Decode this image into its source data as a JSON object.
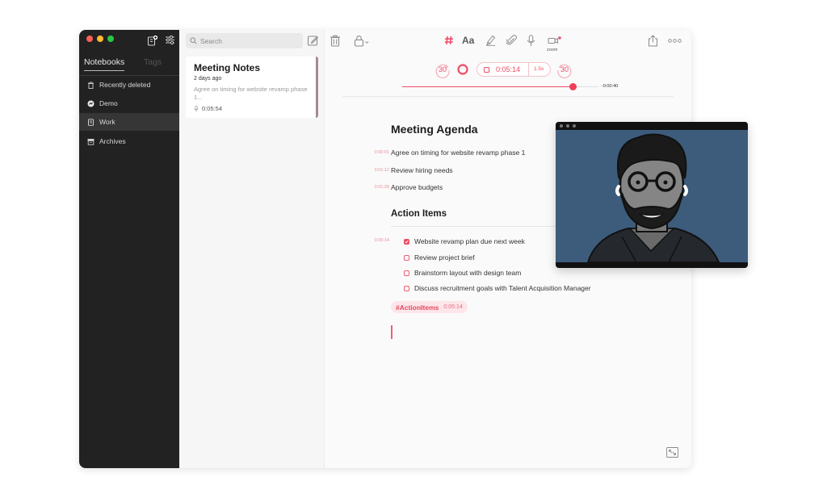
{
  "sidebar": {
    "tabs": [
      "Notebooks",
      "Tags"
    ],
    "items": [
      {
        "label": "Recently deleted",
        "icon": "trash-icon"
      },
      {
        "label": "Demo",
        "icon": "demo-icon"
      },
      {
        "label": "Work",
        "icon": "notebook-icon",
        "active": true
      },
      {
        "label": "Archives",
        "icon": "archive-icon"
      }
    ]
  },
  "toolbar": {
    "search_placeholder": "Search",
    "format_label": "Aa",
    "zoom_label": "zoom"
  },
  "note_card": {
    "title": "Meeting Notes",
    "date": "2 days ago",
    "preview": "Agree on timing for website revamp phase 1...",
    "duration": "0:05:54"
  },
  "audio": {
    "skip_back": "30",
    "skip_forward": "30",
    "time": "0:05:14",
    "speed": "1.5x",
    "remaining": "-0:00:40",
    "progress": 0.87
  },
  "editor": {
    "agenda_title": "Meeting Agenda",
    "agenda": [
      {
        "ts": "0:00:01",
        "text": "Agree on timing for website revamp phase 1"
      },
      {
        "ts": "0:01:12",
        "text": "Review hiring needs"
      },
      {
        "ts": "0:01:39",
        "text": "Approve budgets"
      }
    ],
    "actions_title": "Action Items",
    "actions_ts": "0:05:14",
    "tasks": [
      {
        "text": "Website revamp plan due next week",
        "checked": true
      },
      {
        "text": "Review project brief",
        "checked": false
      },
      {
        "text": "Brainstorm layout with design team",
        "checked": false
      },
      {
        "text": "Discuss recruitment goals with Talent Acquisition Manager",
        "checked": false
      }
    ],
    "tag": "#ActionItems",
    "tag_time": "0:05:14"
  },
  "colors": {
    "accent": "#ef4d66",
    "sidebar_bg": "#222222",
    "video_bg": "#3d5c7c"
  }
}
